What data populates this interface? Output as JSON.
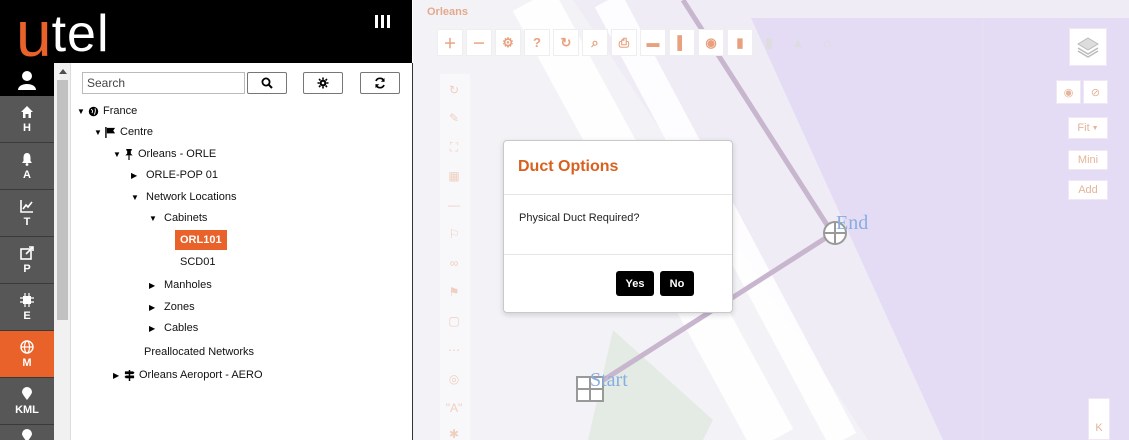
{
  "logo": {
    "part1": "u",
    "part2": "tel"
  },
  "nav": {
    "items": [
      {
        "label": "H",
        "icon": "home-icon"
      },
      {
        "label": "A",
        "icon": "bell-icon"
      },
      {
        "label": "T",
        "icon": "chart-icon"
      },
      {
        "label": "P",
        "icon": "share-icon"
      },
      {
        "label": "E",
        "icon": "chip-icon"
      },
      {
        "label": "M",
        "icon": "globe-icon",
        "active": true
      },
      {
        "label": "KML",
        "icon": "pin-icon"
      }
    ]
  },
  "search": {
    "placeholder": "Search"
  },
  "tree": {
    "france": "France",
    "centre": "Centre",
    "orleans": "Orleans - ORLE",
    "orle_pop": "ORLE-POP 01",
    "network_locations": "Network Locations",
    "cabinets": "Cabinets",
    "orl101": "ORL101",
    "scd01": "SCD01",
    "manholes": "Manholes",
    "zones": "Zones",
    "cables": "Cables",
    "preallocated": "Preallocated Networks",
    "aeroport": "Orleans Aeroport - AERO"
  },
  "map": {
    "title": "Orleans",
    "start_label": "Start",
    "end_label": "End",
    "right_buttons": {
      "fit": "Fit",
      "mini": "Mini",
      "add": "Add",
      "k": "K"
    }
  },
  "dialog": {
    "title": "Duct Options",
    "message": "Physical Duct Required?",
    "yes": "Yes",
    "no": "No"
  },
  "colors": {
    "brand": "#e8622a",
    "nav_bg": "#575757",
    "map_zone": "#e4dbf4"
  }
}
